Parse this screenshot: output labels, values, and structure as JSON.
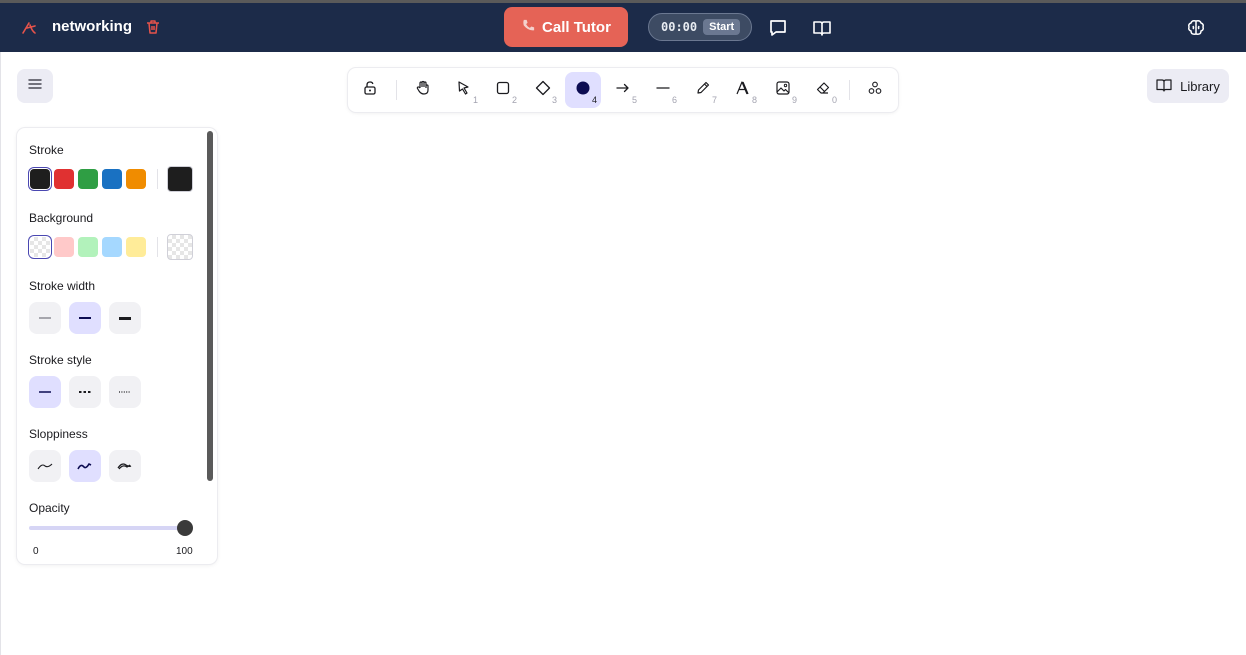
{
  "header": {
    "project_name": "networking",
    "call_button_label": "Call Tutor",
    "timer_value": "00:00",
    "timer_start_label": "Start"
  },
  "toolbar": {
    "tools": [
      {
        "name": "lock",
        "key": ""
      },
      {
        "name": "hand",
        "key": ""
      },
      {
        "name": "selection",
        "key": "1"
      },
      {
        "name": "rectangle",
        "key": "2"
      },
      {
        "name": "diamond",
        "key": "3"
      },
      {
        "name": "ellipse",
        "key": "4",
        "active": true
      },
      {
        "name": "arrow",
        "key": "5"
      },
      {
        "name": "line",
        "key": "6"
      },
      {
        "name": "draw",
        "key": "7"
      },
      {
        "name": "text",
        "key": "8"
      },
      {
        "name": "image",
        "key": "9"
      },
      {
        "name": "eraser",
        "key": "0"
      },
      {
        "name": "more-tools",
        "key": ""
      }
    ],
    "library_label": "Library"
  },
  "panel": {
    "stroke_label": "Stroke",
    "stroke_colors": [
      "#1e1e1e",
      "#e03131",
      "#2f9e44",
      "#1971c2",
      "#f08c00"
    ],
    "stroke_current": "#1e1e1e",
    "background_label": "Background",
    "background_colors": [
      "transparent",
      "#ffc9c9",
      "#b2f2bb",
      "#a5d8ff",
      "#ffec99"
    ],
    "background_current": "transparent",
    "stroke_width_label": "Stroke width",
    "stroke_width_options": [
      "thin",
      "bold",
      "extra-bold"
    ],
    "stroke_width_selected": "bold",
    "stroke_style_label": "Stroke style",
    "stroke_style_options": [
      "solid",
      "dashed",
      "dotted"
    ],
    "stroke_style_selected": "solid",
    "sloppiness_label": "Sloppiness",
    "sloppiness_options": [
      "architect",
      "artist",
      "cartoonist"
    ],
    "sloppiness_selected": "artist",
    "opacity_label": "Opacity",
    "opacity_min": "0",
    "opacity_max": "100",
    "opacity_value": 100
  }
}
